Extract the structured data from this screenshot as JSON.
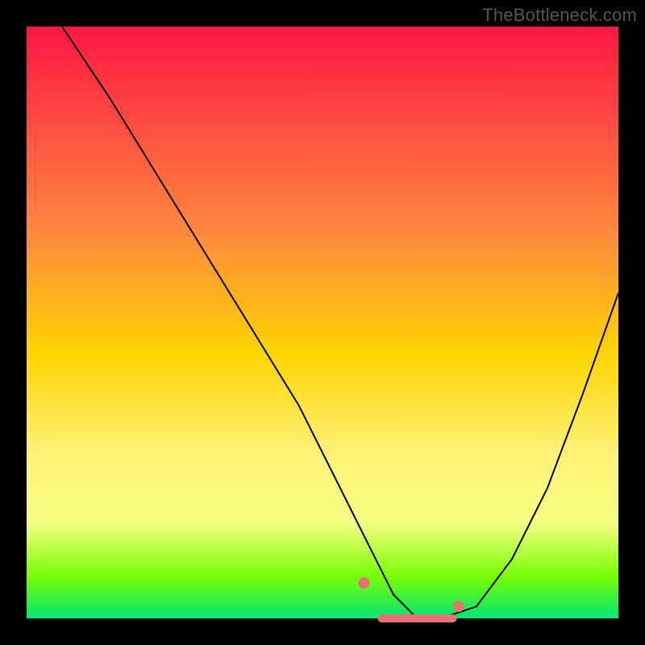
{
  "watermark": "TheBottleneck.com",
  "chart_data": {
    "type": "line",
    "title": "",
    "xlabel": "",
    "ylabel": "",
    "xlim": [
      0,
      100
    ],
    "ylim": [
      0,
      100
    ],
    "background_gradient_stops": [
      {
        "offset": 0,
        "color": "#ff1744"
      },
      {
        "offset": 35,
        "color": "#ff8a3d"
      },
      {
        "offset": 55,
        "color": "#ffd400"
      },
      {
        "offset": 72,
        "color": "#fff176"
      },
      {
        "offset": 84,
        "color": "#f4ff81"
      },
      {
        "offset": 93,
        "color": "#76ff03"
      },
      {
        "offset": 100,
        "color": "#00e676"
      }
    ],
    "series": [
      {
        "name": "bottleneck-curve",
        "x": [
          6,
          14,
          22,
          30,
          38,
          46,
          52,
          58,
          62,
          66,
          70,
          76,
          82,
          88,
          94,
          100
        ],
        "y": [
          100,
          88,
          75,
          62,
          49,
          36,
          24,
          12,
          4,
          0,
          0,
          2,
          10,
          22,
          38,
          55
        ]
      }
    ],
    "markers": [
      {
        "name": "flat-left-end",
        "x": 57,
        "y": 6,
        "color": "#e57373"
      },
      {
        "name": "flat-right-end",
        "x": 73,
        "y": 2,
        "color": "#e57373"
      }
    ],
    "flat_bottom_segment": {
      "x": [
        60,
        62,
        64,
        66,
        68,
        70,
        72
      ],
      "y": [
        0,
        0,
        0,
        0,
        0,
        0,
        0
      ],
      "color": "#e57373"
    }
  }
}
